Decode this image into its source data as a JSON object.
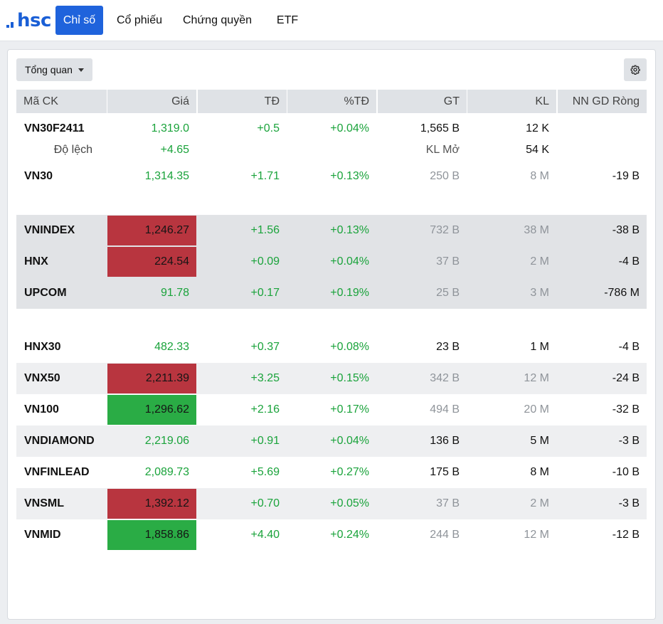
{
  "nav": {
    "logo_text": "hsc",
    "tabs": [
      {
        "label": "Chỉ số",
        "active": true
      },
      {
        "label": "Cổ phiếu",
        "active": false
      },
      {
        "label": "Chứng quyền",
        "active": false
      },
      {
        "label": "ETF",
        "active": false
      }
    ]
  },
  "toolbar": {
    "view_selected": "Tổng quan",
    "settings_icon": "gear-icon"
  },
  "table": {
    "columns": [
      "Mã CK",
      "Giá",
      "TĐ",
      "%TĐ",
      "GT",
      "KL",
      "NN GD Ròng"
    ],
    "future": {
      "symbol": "VN30F2411",
      "price": "1,319.0",
      "change": "+0.5",
      "pct": "+0.04%",
      "value": "1,565 B",
      "volume": "12 K",
      "sub_label": "Độ lệch",
      "sub_change": "+4.65",
      "sub_label2": "KL Mở",
      "sub_volume": "54 K"
    },
    "rows": [
      {
        "symbol": "VN30",
        "price": "1,314.35",
        "change": "+1.71",
        "pct": "+0.13%",
        "value": "250 B",
        "volume": "8 M",
        "foreign": "-19 B"
      },
      {
        "symbol": "VNINDEX",
        "price": "1,246.27",
        "change": "+1.56",
        "pct": "+0.13%",
        "value": "732 B",
        "volume": "38 M",
        "foreign": "-38 B"
      },
      {
        "symbol": "HNX",
        "price": "224.54",
        "change": "+0.09",
        "pct": "+0.04%",
        "value": "37 B",
        "volume": "2 M",
        "foreign": "-4 B"
      },
      {
        "symbol": "UPCOM",
        "price": "91.78",
        "change": "+0.17",
        "pct": "+0.19%",
        "value": "25 B",
        "volume": "3 M",
        "foreign": "-786 M"
      },
      {
        "symbol": "HNX30",
        "price": "482.33",
        "change": "+0.37",
        "pct": "+0.08%",
        "value": "23 B",
        "volume": "1 M",
        "foreign": "-4 B"
      },
      {
        "symbol": "VNX50",
        "price": "2,211.39",
        "change": "+3.25",
        "pct": "+0.15%",
        "value": "342 B",
        "volume": "12 M",
        "foreign": "-24 B"
      },
      {
        "symbol": "VN100",
        "price": "1,296.62",
        "change": "+2.16",
        "pct": "+0.17%",
        "value": "494 B",
        "volume": "20 M",
        "foreign": "-32 B"
      },
      {
        "symbol": "VNDIAMOND",
        "price": "2,219.06",
        "change": "+0.91",
        "pct": "+0.04%",
        "value": "136 B",
        "volume": "5 M",
        "foreign": "-3 B"
      },
      {
        "symbol": "VNFINLEAD",
        "price": "2,089.73",
        "change": "+5.69",
        "pct": "+0.27%",
        "value": "175 B",
        "volume": "8 M",
        "foreign": "-10 B"
      },
      {
        "symbol": "VNSML",
        "price": "1,392.12",
        "change": "+0.70",
        "pct": "+0.05%",
        "value": "37 B",
        "volume": "2 M",
        "foreign": "-3 B"
      },
      {
        "symbol": "VNMID",
        "price": "1,858.86",
        "change": "+4.40",
        "pct": "+0.24%",
        "value": "244 B",
        "volume": "12 M",
        "foreign": "-12 B"
      }
    ]
  },
  "colors": {
    "accent": "#1f63dc",
    "up": "#1aa33b",
    "flash_red": "#b8353f",
    "flash_green": "#2aac45"
  }
}
